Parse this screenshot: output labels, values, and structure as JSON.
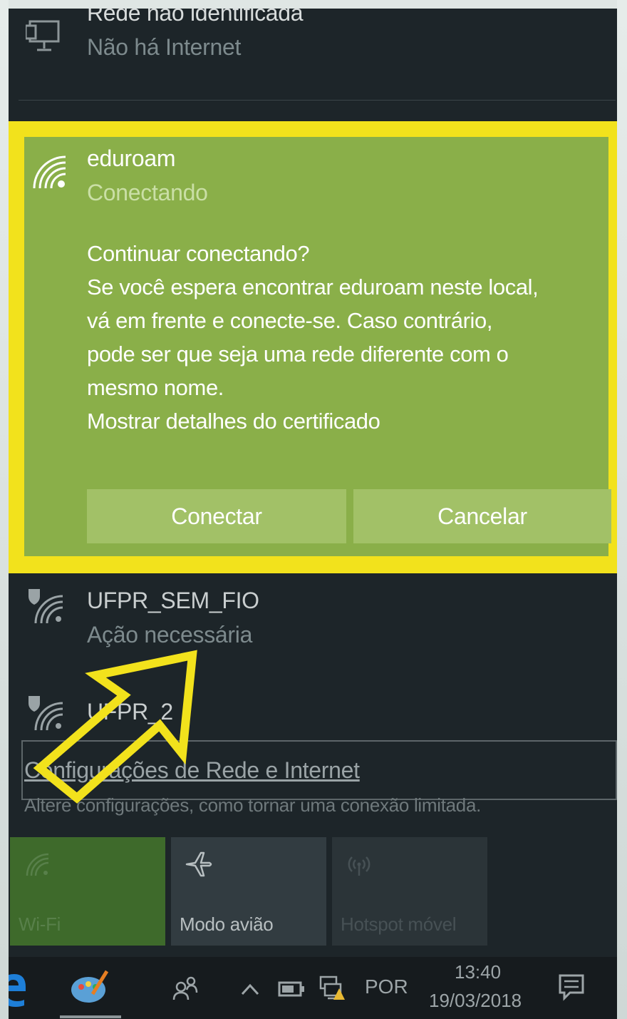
{
  "networks": {
    "unidentified": {
      "title": "Rede não identificada",
      "status": "Não há Internet",
      "icon": "monitor-icon"
    },
    "selected": {
      "ssid": "eduroam",
      "status": "Conectando",
      "icon": "wifi-icon",
      "message": {
        "question": "Continuar conectando?",
        "line1": "Se você espera encontrar eduroam neste local,",
        "line2": "vá em frente e conecte-se. Caso contrário,",
        "line3": "pode ser que seja uma rede diferente com o",
        "line4": "mesmo nome.",
        "cert_link": "Mostrar detalhes do certificado"
      },
      "buttons": {
        "connect": "Conectar",
        "cancel": "Cancelar"
      }
    },
    "list": [
      {
        "ssid": "UFPR_SEM_FIO",
        "status": "Ação necessária",
        "icon": "wifi-secured-icon"
      },
      {
        "ssid": "UFPR_2",
        "status": "",
        "icon": "wifi-secured-icon"
      }
    ]
  },
  "settings": {
    "link": "Configurações de Rede e Internet",
    "desc": "Altere configurações, como tornar uma conexão limitada."
  },
  "quick_actions": {
    "wifi": "Wi-Fi",
    "airplane": "Modo avião",
    "hotspot": "Hotspot móvel"
  },
  "taskbar": {
    "language": "POR",
    "time": "13:40",
    "date": "19/03/2018"
  },
  "colors": {
    "highlight": "#f2e21c",
    "eduroam_bg": "#8aaf49",
    "panel_bg": "#1d2529",
    "wifi_tile": "#3e6a2b"
  }
}
